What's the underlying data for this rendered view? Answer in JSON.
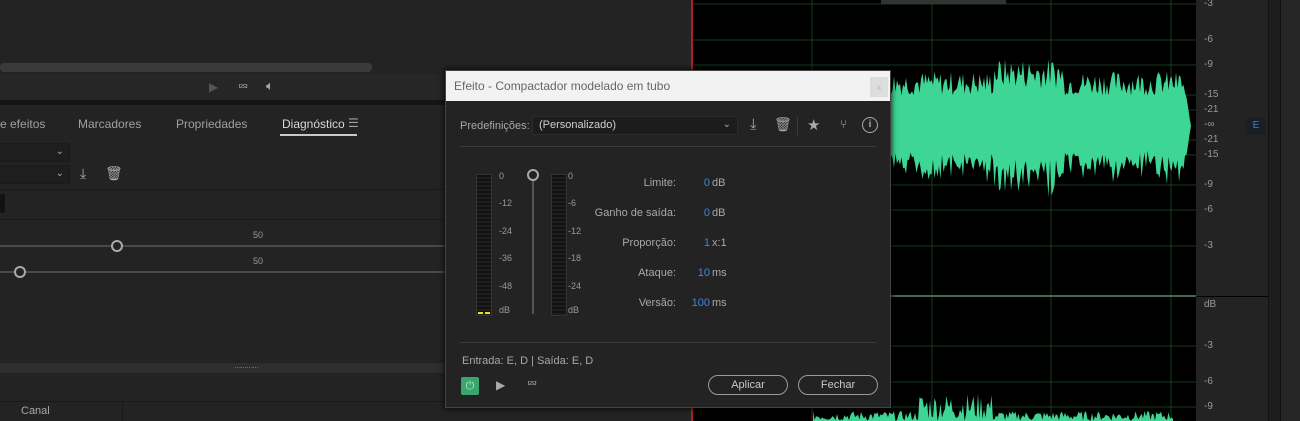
{
  "left_panel": {
    "tabs": [
      {
        "label": "e efeitos"
      },
      {
        "label": "Marcadores"
      },
      {
        "label": "Propriedades"
      },
      {
        "label": "Diagnóstico",
        "active": true
      }
    ],
    "slider_label_1": "50",
    "slider_label_2": "50",
    "table_header": "Canal"
  },
  "ruler": {
    "upper": [
      "-3",
      "-6",
      "-9",
      "-15",
      "-21",
      "-∞",
      "-21",
      "-15",
      "-9",
      "-6",
      "-3"
    ],
    "unit": "dB",
    "lower": [
      "-3",
      "-6",
      "-9"
    ],
    "channel_badge": "E"
  },
  "dialog": {
    "title": "Efeito - Compactador modelado em tubo",
    "close": "x",
    "presets_label": "Predefinições:",
    "preset_value": "(Personalizado)",
    "meter_in_scale": [
      "0",
      "-12",
      "-24",
      "-36",
      "-48",
      "dB"
    ],
    "meter_out_scale": [
      "0",
      "-6",
      "-12",
      "-18",
      "-24",
      "dB"
    ],
    "params": [
      {
        "name": "Limite:",
        "value": "0",
        "unit": "dB"
      },
      {
        "name": "Ganho de saída:",
        "value": "0",
        "unit": "dB"
      },
      {
        "name": "Proporção:",
        "value": "1",
        "unit": "x:1"
      },
      {
        "name": "Ataque:",
        "value": "10",
        "unit": "ms"
      },
      {
        "name": "Versão:",
        "value": "100",
        "unit": "ms"
      }
    ],
    "io": "Entrada: E, D | Saída: E, D",
    "apply": "Aplicar",
    "close_btn": "Fechar",
    "colors": {
      "accent": "#3f86e0",
      "power": "#3aa66e",
      "waveform": "#3ed694"
    }
  }
}
